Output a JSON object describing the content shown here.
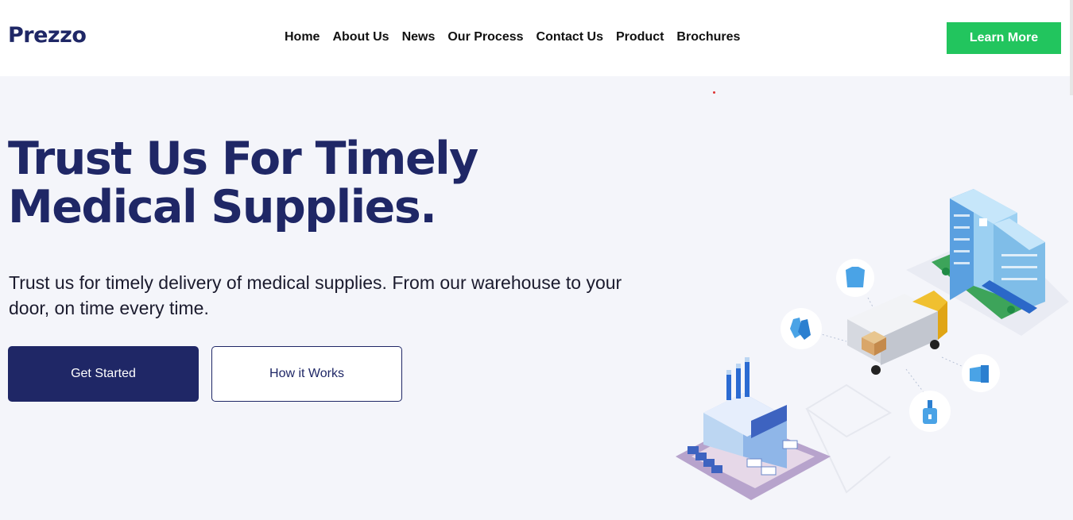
{
  "header": {
    "logo": "Prezzo",
    "nav": [
      "Home",
      "About Us",
      "News",
      "Our Process",
      "Contact Us",
      "Product",
      "Brochures"
    ],
    "cta": "Learn More"
  },
  "hero": {
    "title_line1": "Trust Us For Timely",
    "title_line2": "Medical Supplies.",
    "description": "Trust us for timely delivery of medical supplies. From our warehouse to your door, on time every time.",
    "primary_button": "Get Started",
    "secondary_button": "How it Works"
  },
  "colors": {
    "brand": "#1f2766",
    "accent": "#22c55e",
    "background": "#f4f5fa"
  },
  "illustration": {
    "icons": [
      "hospital-icon",
      "delivery-truck-icon",
      "factory-icon",
      "gown-icon",
      "gloves-icon",
      "mask-icon",
      "sanitizer-icon"
    ]
  }
}
